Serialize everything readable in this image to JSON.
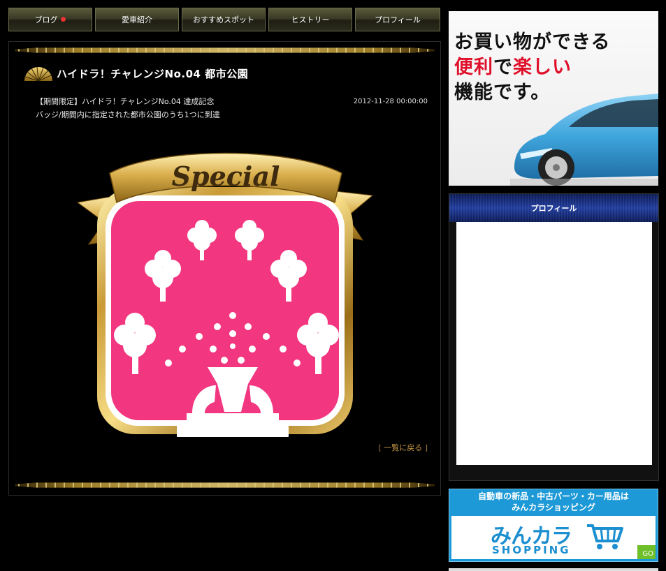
{
  "nav": {
    "tabs": [
      {
        "label": "ブログ",
        "badge": "●"
      },
      {
        "label": "愛車紹介"
      },
      {
        "label": "おすすめスポット"
      },
      {
        "label": "ヒストリー"
      },
      {
        "label": "プロフィール"
      }
    ]
  },
  "post": {
    "title": "ハイドラ！チャレンジNo.04 都市公園",
    "description": "【期間限定】ハイドラ！チャレンジNo.04 達成記念バッジ/期間内に指定された都市公園のうち1つに到達",
    "date": "2012-11-28 00:00:00",
    "badge_ribbon": "Special",
    "back_link": {
      "open": "[ ",
      "label": "一覧に戻る",
      "close": " ]"
    }
  },
  "sidebar": {
    "ad": {
      "line1": "お買い物ができる",
      "line2_a": "便利",
      "line2_b": "で",
      "line2_c": "楽しい",
      "line3": "機能です。"
    },
    "profile_heading": "プロフィール",
    "shop": {
      "top_line1": "自動車の新品・中古パーツ・カー用品は",
      "top_line2": "みんカラショッピング",
      "logo_text": "みんカラ",
      "logo_word": "SHOPPING",
      "go_label": "GO"
    }
  },
  "colors": {
    "badge_pink": "#f2367f",
    "gold": "#c9a13c",
    "profile_blue": "#1d3a9a",
    "shop_blue": "#1c99d6",
    "accent_red": "#e0102a"
  }
}
